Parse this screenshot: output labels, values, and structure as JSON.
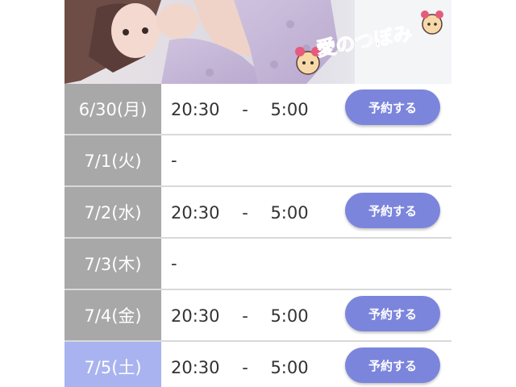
{
  "banner": {
    "logo_text": "愛のつぼみ"
  },
  "schedule": [
    {
      "date": "6/30(月)",
      "time": "20:30　 -　 5:00",
      "button": "予約する",
      "highlight": false
    },
    {
      "date": "7/1(火)",
      "time": "-",
      "button": null,
      "highlight": false
    },
    {
      "date": "7/2(水)",
      "time": "20:30　 -　 5:00",
      "button": "予約する",
      "highlight": false
    },
    {
      "date": "7/3(木)",
      "time": "-",
      "button": null,
      "highlight": false
    },
    {
      "date": "7/4(金)",
      "time": "20:30　 -　 5:00",
      "button": "予約する",
      "highlight": false
    },
    {
      "date": "7/5(土)",
      "time": "20:30　 -　 5:00",
      "button": "予約する",
      "highlight": true
    }
  ],
  "colors": {
    "date_bg": "#a8a8a8",
    "date_today_bg": "#a9b3f0",
    "button_bg": "#7b85dc"
  }
}
